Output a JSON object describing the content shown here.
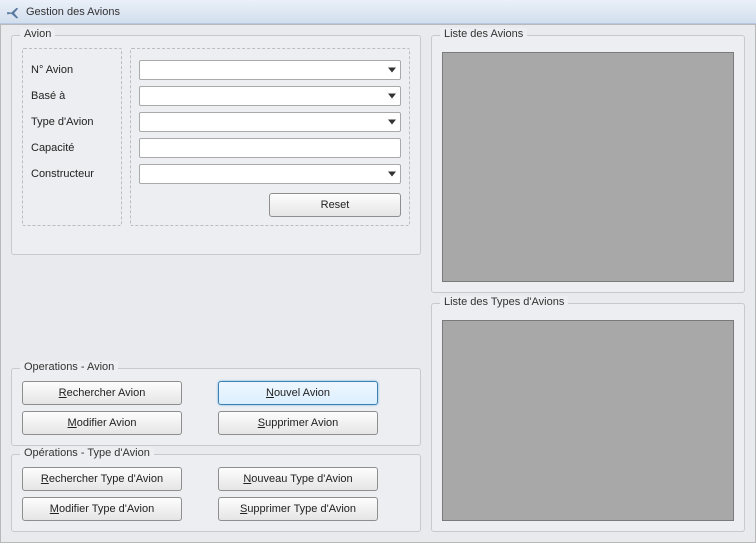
{
  "window": {
    "title": "Gestion des Avions"
  },
  "avion_group": {
    "legend": "Avion",
    "labels": {
      "num": "N° Avion",
      "base": "Basé à",
      "type": "Type d'Avion",
      "cap": "Capacité",
      "cons": "Constructeur"
    },
    "values": {
      "num": "",
      "base": "",
      "type": "",
      "cap": "",
      "cons": ""
    },
    "reset": "Reset"
  },
  "ops_avion": {
    "legend": "Operations - Avion",
    "search_pre": "R",
    "search_post": "echercher Avion",
    "new_pre": "N",
    "new_post": "ouvel Avion",
    "mod_pre": "M",
    "mod_post": "odifier Avion",
    "del_pre": "S",
    "del_post": "upprimer Avion"
  },
  "ops_type": {
    "legend": "Opérations - Type d'Avion",
    "search_pre": "R",
    "search_post": "echercher Type d'Avion",
    "new_pre": "N",
    "new_post": "ouveau Type d'Avion",
    "mod_pre": "M",
    "mod_post": "odifier Type d'Avion",
    "del_pre": "S",
    "del_post": "upprimer Type d'Avion"
  },
  "lists": {
    "avions_legend": "Liste des Avions",
    "types_legend": "Liste des Types d'Avions"
  }
}
